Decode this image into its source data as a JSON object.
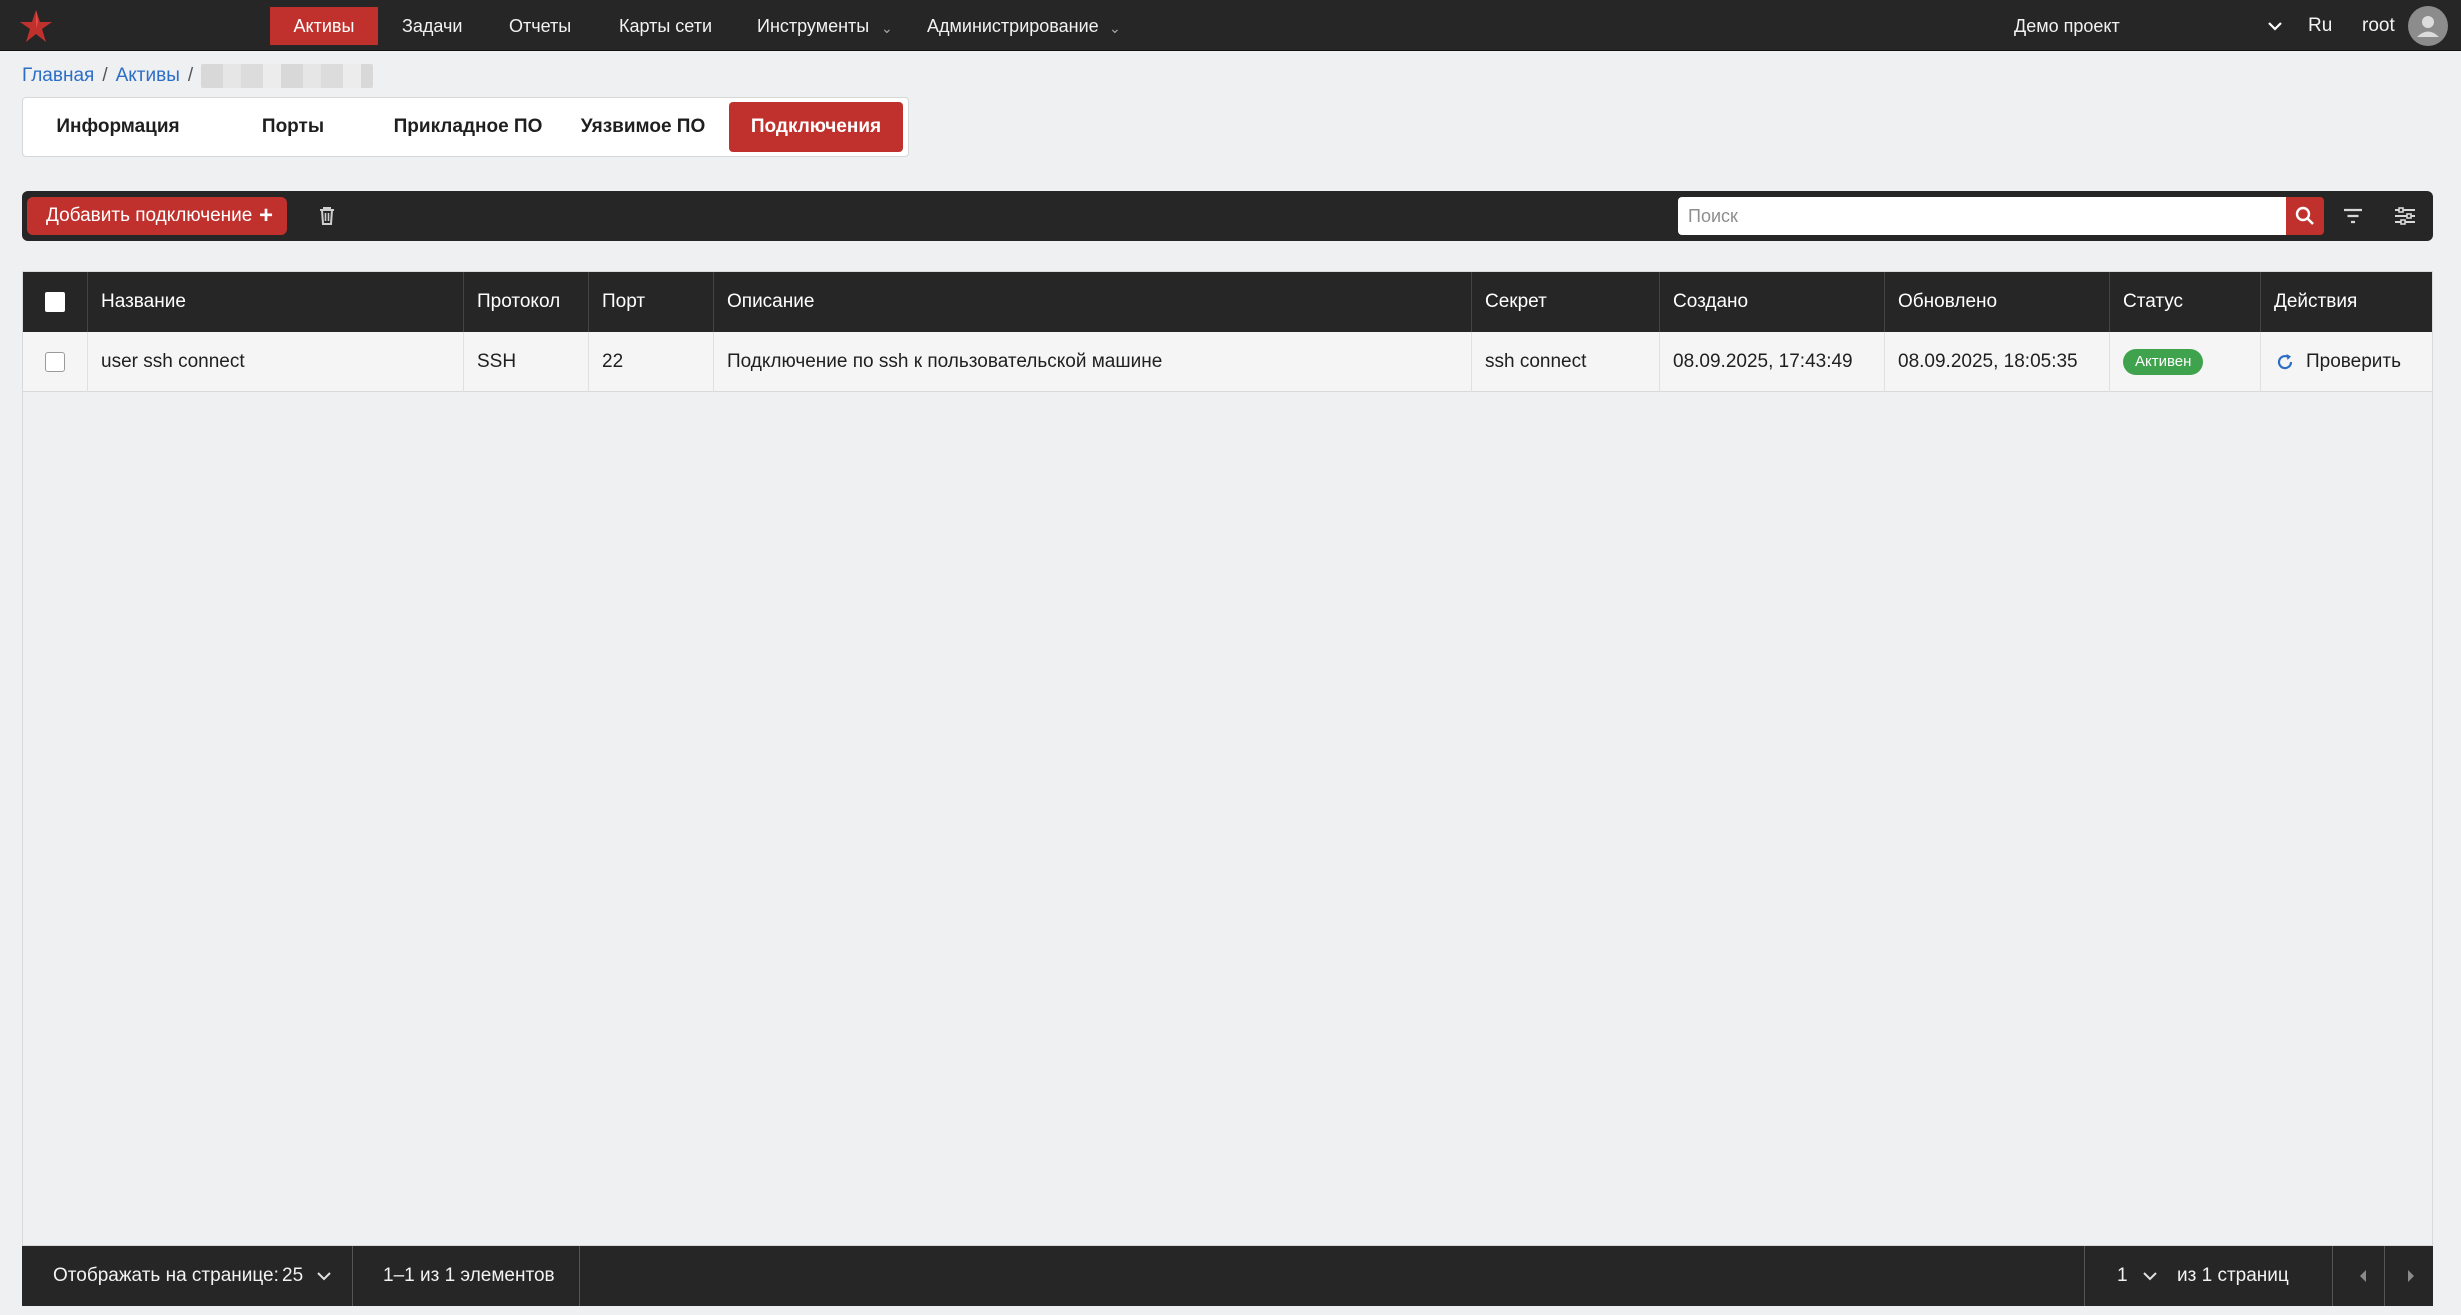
{
  "nav": {
    "items": [
      {
        "label": "Активы",
        "active": true
      },
      {
        "label": "Задачи"
      },
      {
        "label": "Отчеты"
      },
      {
        "label": "Карты сети"
      },
      {
        "label": "Инструменты"
      },
      {
        "label": "Администрирование"
      }
    ],
    "project": "Демо проект",
    "lang": "Ru",
    "user": "root",
    "brand_color": "#c0312d"
  },
  "breadcrumb": {
    "items": [
      "Главная",
      "Активы"
    ]
  },
  "tabs": [
    {
      "label": "Информация"
    },
    {
      "label": "Порты"
    },
    {
      "label": "Прикладное ПО"
    },
    {
      "label": "Уязвимое ПО"
    },
    {
      "label": "Подключения",
      "active": true
    }
  ],
  "toolbar": {
    "add_label": "Добавить подключение",
    "search_placeholder": "Поиск"
  },
  "table": {
    "columns": [
      "Название",
      "Протокол",
      "Порт",
      "Описание",
      "Секрет",
      "Создано",
      "Обновлено",
      "Статус",
      "Действия"
    ],
    "rows": [
      {
        "name": "user ssh connect",
        "protocol": "SSH",
        "port": "22",
        "description": "Подключение по ssh к пользовательской машине",
        "secret": "ssh connect",
        "created": "08.09.2025, 17:43:49",
        "updated": "08.09.2025, 18:05:35",
        "status": "Активен",
        "action": "Проверить"
      }
    ]
  },
  "footer": {
    "per_page_label": "Отображать на странице:",
    "per_page_value": "25",
    "range_text": "1–1 из 1 элементов",
    "page_value": "1",
    "pages_text": "из 1 страниц"
  },
  "status_color": "#3fa34d",
  "link_color": "#2a6ec6"
}
